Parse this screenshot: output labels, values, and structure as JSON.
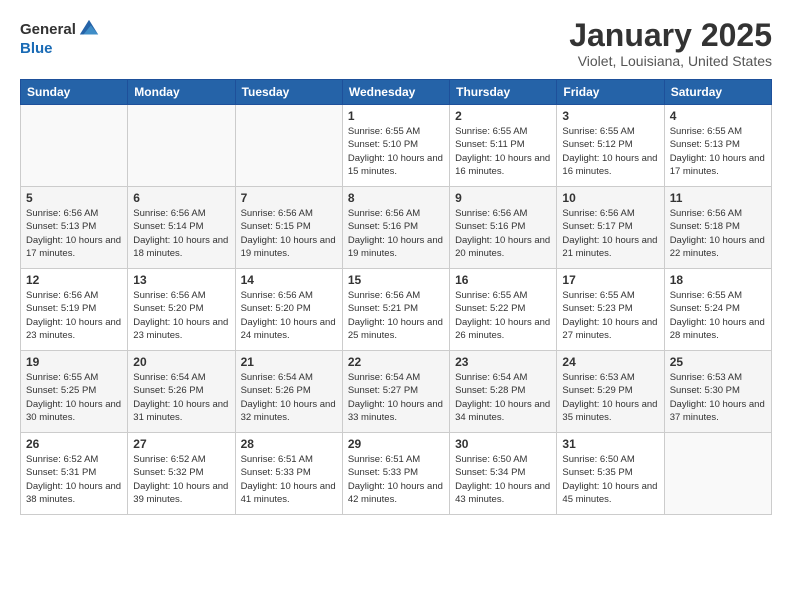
{
  "header": {
    "logo_general": "General",
    "logo_blue": "Blue",
    "month_title": "January 2025",
    "location": "Violet, Louisiana, United States"
  },
  "days_of_week": [
    "Sunday",
    "Monday",
    "Tuesday",
    "Wednesday",
    "Thursday",
    "Friday",
    "Saturday"
  ],
  "weeks": [
    [
      {
        "day": "",
        "sunrise": "",
        "sunset": "",
        "daylight": ""
      },
      {
        "day": "",
        "sunrise": "",
        "sunset": "",
        "daylight": ""
      },
      {
        "day": "",
        "sunrise": "",
        "sunset": "",
        "daylight": ""
      },
      {
        "day": "1",
        "sunrise": "Sunrise: 6:55 AM",
        "sunset": "Sunset: 5:10 PM",
        "daylight": "Daylight: 10 hours and 15 minutes."
      },
      {
        "day": "2",
        "sunrise": "Sunrise: 6:55 AM",
        "sunset": "Sunset: 5:11 PM",
        "daylight": "Daylight: 10 hours and 16 minutes."
      },
      {
        "day": "3",
        "sunrise": "Sunrise: 6:55 AM",
        "sunset": "Sunset: 5:12 PM",
        "daylight": "Daylight: 10 hours and 16 minutes."
      },
      {
        "day": "4",
        "sunrise": "Sunrise: 6:55 AM",
        "sunset": "Sunset: 5:13 PM",
        "daylight": "Daylight: 10 hours and 17 minutes."
      }
    ],
    [
      {
        "day": "5",
        "sunrise": "Sunrise: 6:56 AM",
        "sunset": "Sunset: 5:13 PM",
        "daylight": "Daylight: 10 hours and 17 minutes."
      },
      {
        "day": "6",
        "sunrise": "Sunrise: 6:56 AM",
        "sunset": "Sunset: 5:14 PM",
        "daylight": "Daylight: 10 hours and 18 minutes."
      },
      {
        "day": "7",
        "sunrise": "Sunrise: 6:56 AM",
        "sunset": "Sunset: 5:15 PM",
        "daylight": "Daylight: 10 hours and 19 minutes."
      },
      {
        "day": "8",
        "sunrise": "Sunrise: 6:56 AM",
        "sunset": "Sunset: 5:16 PM",
        "daylight": "Daylight: 10 hours and 19 minutes."
      },
      {
        "day": "9",
        "sunrise": "Sunrise: 6:56 AM",
        "sunset": "Sunset: 5:16 PM",
        "daylight": "Daylight: 10 hours and 20 minutes."
      },
      {
        "day": "10",
        "sunrise": "Sunrise: 6:56 AM",
        "sunset": "Sunset: 5:17 PM",
        "daylight": "Daylight: 10 hours and 21 minutes."
      },
      {
        "day": "11",
        "sunrise": "Sunrise: 6:56 AM",
        "sunset": "Sunset: 5:18 PM",
        "daylight": "Daylight: 10 hours and 22 minutes."
      }
    ],
    [
      {
        "day": "12",
        "sunrise": "Sunrise: 6:56 AM",
        "sunset": "Sunset: 5:19 PM",
        "daylight": "Daylight: 10 hours and 23 minutes."
      },
      {
        "day": "13",
        "sunrise": "Sunrise: 6:56 AM",
        "sunset": "Sunset: 5:20 PM",
        "daylight": "Daylight: 10 hours and 23 minutes."
      },
      {
        "day": "14",
        "sunrise": "Sunrise: 6:56 AM",
        "sunset": "Sunset: 5:20 PM",
        "daylight": "Daylight: 10 hours and 24 minutes."
      },
      {
        "day": "15",
        "sunrise": "Sunrise: 6:56 AM",
        "sunset": "Sunset: 5:21 PM",
        "daylight": "Daylight: 10 hours and 25 minutes."
      },
      {
        "day": "16",
        "sunrise": "Sunrise: 6:55 AM",
        "sunset": "Sunset: 5:22 PM",
        "daylight": "Daylight: 10 hours and 26 minutes."
      },
      {
        "day": "17",
        "sunrise": "Sunrise: 6:55 AM",
        "sunset": "Sunset: 5:23 PM",
        "daylight": "Daylight: 10 hours and 27 minutes."
      },
      {
        "day": "18",
        "sunrise": "Sunrise: 6:55 AM",
        "sunset": "Sunset: 5:24 PM",
        "daylight": "Daylight: 10 hours and 28 minutes."
      }
    ],
    [
      {
        "day": "19",
        "sunrise": "Sunrise: 6:55 AM",
        "sunset": "Sunset: 5:25 PM",
        "daylight": "Daylight: 10 hours and 30 minutes."
      },
      {
        "day": "20",
        "sunrise": "Sunrise: 6:54 AM",
        "sunset": "Sunset: 5:26 PM",
        "daylight": "Daylight: 10 hours and 31 minutes."
      },
      {
        "day": "21",
        "sunrise": "Sunrise: 6:54 AM",
        "sunset": "Sunset: 5:26 PM",
        "daylight": "Daylight: 10 hours and 32 minutes."
      },
      {
        "day": "22",
        "sunrise": "Sunrise: 6:54 AM",
        "sunset": "Sunset: 5:27 PM",
        "daylight": "Daylight: 10 hours and 33 minutes."
      },
      {
        "day": "23",
        "sunrise": "Sunrise: 6:54 AM",
        "sunset": "Sunset: 5:28 PM",
        "daylight": "Daylight: 10 hours and 34 minutes."
      },
      {
        "day": "24",
        "sunrise": "Sunrise: 6:53 AM",
        "sunset": "Sunset: 5:29 PM",
        "daylight": "Daylight: 10 hours and 35 minutes."
      },
      {
        "day": "25",
        "sunrise": "Sunrise: 6:53 AM",
        "sunset": "Sunset: 5:30 PM",
        "daylight": "Daylight: 10 hours and 37 minutes."
      }
    ],
    [
      {
        "day": "26",
        "sunrise": "Sunrise: 6:52 AM",
        "sunset": "Sunset: 5:31 PM",
        "daylight": "Daylight: 10 hours and 38 minutes."
      },
      {
        "day": "27",
        "sunrise": "Sunrise: 6:52 AM",
        "sunset": "Sunset: 5:32 PM",
        "daylight": "Daylight: 10 hours and 39 minutes."
      },
      {
        "day": "28",
        "sunrise": "Sunrise: 6:51 AM",
        "sunset": "Sunset: 5:33 PM",
        "daylight": "Daylight: 10 hours and 41 minutes."
      },
      {
        "day": "29",
        "sunrise": "Sunrise: 6:51 AM",
        "sunset": "Sunset: 5:33 PM",
        "daylight": "Daylight: 10 hours and 42 minutes."
      },
      {
        "day": "30",
        "sunrise": "Sunrise: 6:50 AM",
        "sunset": "Sunset: 5:34 PM",
        "daylight": "Daylight: 10 hours and 43 minutes."
      },
      {
        "day": "31",
        "sunrise": "Sunrise: 6:50 AM",
        "sunset": "Sunset: 5:35 PM",
        "daylight": "Daylight: 10 hours and 45 minutes."
      },
      {
        "day": "",
        "sunrise": "",
        "sunset": "",
        "daylight": ""
      }
    ]
  ]
}
